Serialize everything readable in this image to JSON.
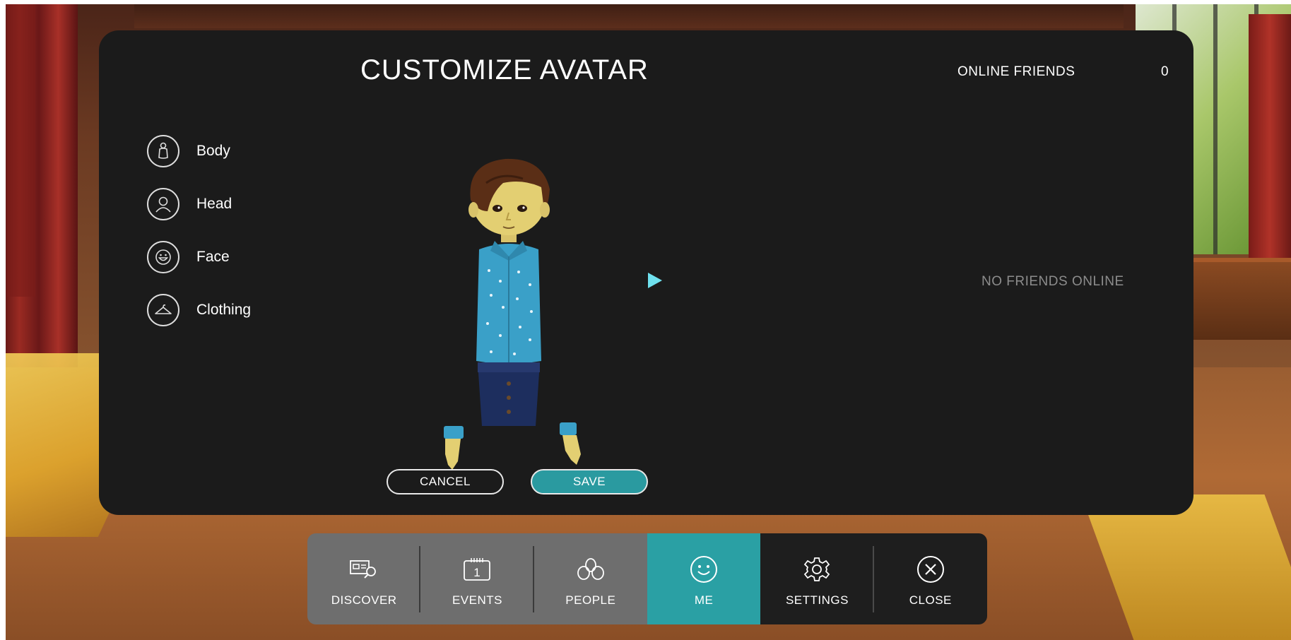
{
  "panel": {
    "title": "CUSTOMIZE AVATAR",
    "online_friends_label": "ONLINE FRIENDS",
    "online_friends_count": "0",
    "no_friends_text": "NO FRIENDS ONLINE"
  },
  "categories": [
    {
      "label": "Body",
      "icon": "body-icon"
    },
    {
      "label": "Head",
      "icon": "head-icon"
    },
    {
      "label": "Face",
      "icon": "face-icon"
    },
    {
      "label": "Clothing",
      "icon": "hanger-icon"
    }
  ],
  "actions": {
    "cancel_label": "CANCEL",
    "save_label": "SAVE"
  },
  "nav": [
    {
      "label": "DISCOVER",
      "icon": "discover-icon"
    },
    {
      "label": "EVENTS",
      "icon": "calendar-icon"
    },
    {
      "label": "PEOPLE",
      "icon": "people-icon"
    },
    {
      "label": "ME",
      "icon": "smiley-icon",
      "active": true
    },
    {
      "label": "SETTINGS",
      "icon": "gear-icon"
    },
    {
      "label": "CLOSE",
      "icon": "close-icon"
    }
  ],
  "colors": {
    "accent": "#2aa0a4",
    "panel": "#1b1b1b",
    "nav_inactive": "#6e6e6e",
    "nav_dark": "#1e1e1e",
    "muted_text": "#8c8c8c"
  }
}
